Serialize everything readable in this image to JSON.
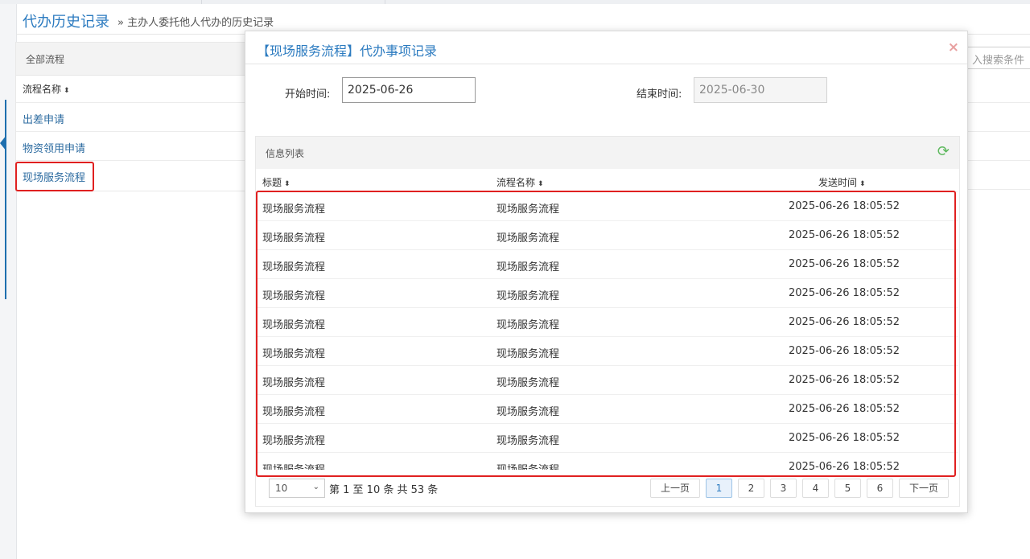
{
  "page": {
    "title": "代办历史记录",
    "subtitle": "» 主办人委托他人代办的历史记录"
  },
  "left_panel": {
    "header": "全部流程",
    "column": "流程名称",
    "items": [
      "出差申请",
      "物资领用申请",
      "现场服务流程"
    ]
  },
  "search": {
    "placeholder": "入搜索条件"
  },
  "modal": {
    "title": "【现场服务流程】代办事项记录",
    "close_icon": "×",
    "start_label": "开始时间:",
    "start_value": "2025-06-26",
    "end_label": "结束时间:",
    "end_value": "2025-06-30",
    "list_title": "信息列表",
    "columns": [
      "标题",
      "流程名称",
      "发送时间"
    ],
    "rows": [
      [
        "现场服务流程",
        "现场服务流程",
        "2025-06-26 18:05:52"
      ],
      [
        "现场服务流程",
        "现场服务流程",
        "2025-06-26 18:05:52"
      ],
      [
        "现场服务流程",
        "现场服务流程",
        "2025-06-26 18:05:52"
      ],
      [
        "现场服务流程",
        "现场服务流程",
        "2025-06-26 18:05:52"
      ],
      [
        "现场服务流程",
        "现场服务流程",
        "2025-06-26 18:05:52"
      ],
      [
        "现场服务流程",
        "现场服务流程",
        "2025-06-26 18:05:52"
      ],
      [
        "现场服务流程",
        "现场服务流程",
        "2025-06-26 18:05:52"
      ],
      [
        "现场服务流程",
        "现场服务流程",
        "2025-06-26 18:05:52"
      ],
      [
        "现场服务流程",
        "现场服务流程",
        "2025-06-26 18:05:52"
      ],
      [
        "现场服务流程",
        "现场服务流程",
        "2025-06-26 18:05:52"
      ]
    ],
    "page_size": "10",
    "page_info": "第 1 至 10 条 共 53 条",
    "prev": "上一页",
    "next": "下一页",
    "pages": [
      "1",
      "2",
      "3",
      "4",
      "5",
      "6"
    ],
    "current_page": "1"
  },
  "colors": {
    "accent": "#2c7bc0",
    "highlight": "#e02020",
    "refresh": "#5cb85c"
  }
}
